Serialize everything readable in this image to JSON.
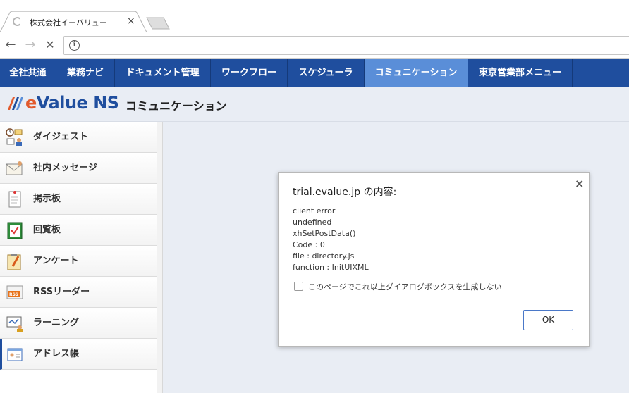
{
  "browser": {
    "tab_title": "株式会社イーバリュー",
    "close_glyph": "×",
    "back_glyph": "←",
    "forward_glyph": "→",
    "stop_glyph": "✕",
    "info_glyph": "i"
  },
  "appnav": {
    "items": [
      {
        "label": "全社共通"
      },
      {
        "label": "業務ナビ"
      },
      {
        "label": "ドキュメント管理"
      },
      {
        "label": "ワークフロー"
      },
      {
        "label": "スケジューラ"
      },
      {
        "label": "コミュニケーション",
        "active": true
      },
      {
        "label": "東京営業部メニュー"
      }
    ]
  },
  "brand": {
    "logo_e": "e",
    "logo_value": "Value",
    "logo_ns": "NS",
    "page_title": "コミュニケーション"
  },
  "sidebar": {
    "items": [
      {
        "label": "ダイジェスト",
        "icon": "digest-icon"
      },
      {
        "label": "社内メッセージ",
        "icon": "message-icon"
      },
      {
        "label": "掲示板",
        "icon": "bulletin-icon"
      },
      {
        "label": "回覧板",
        "icon": "circular-icon"
      },
      {
        "label": "アンケート",
        "icon": "survey-icon"
      },
      {
        "label": "RSSリーダー",
        "icon": "rss-icon"
      },
      {
        "label": "ラーニング",
        "icon": "learning-icon"
      },
      {
        "label": "アドレス帳",
        "icon": "address-book-icon",
        "active": true
      }
    ]
  },
  "dialog": {
    "title": "trial.evalue.jp の内容:",
    "close_glyph": "×",
    "lines": [
      "client error",
      "undefined",
      "xhSetPostData()",
      "Code : 0",
      "file : directory.js",
      "function : InitUIXML"
    ],
    "checkbox_label": "このページでこれ以上ダイアログボックスを生成しない",
    "checkbox_checked": false,
    "ok_label": "OK"
  },
  "colors": {
    "nav_bg": "#1f4e9e",
    "nav_active": "#5a8ed8",
    "page_bg": "#e9edf4",
    "ok_border": "#4a78c8"
  }
}
